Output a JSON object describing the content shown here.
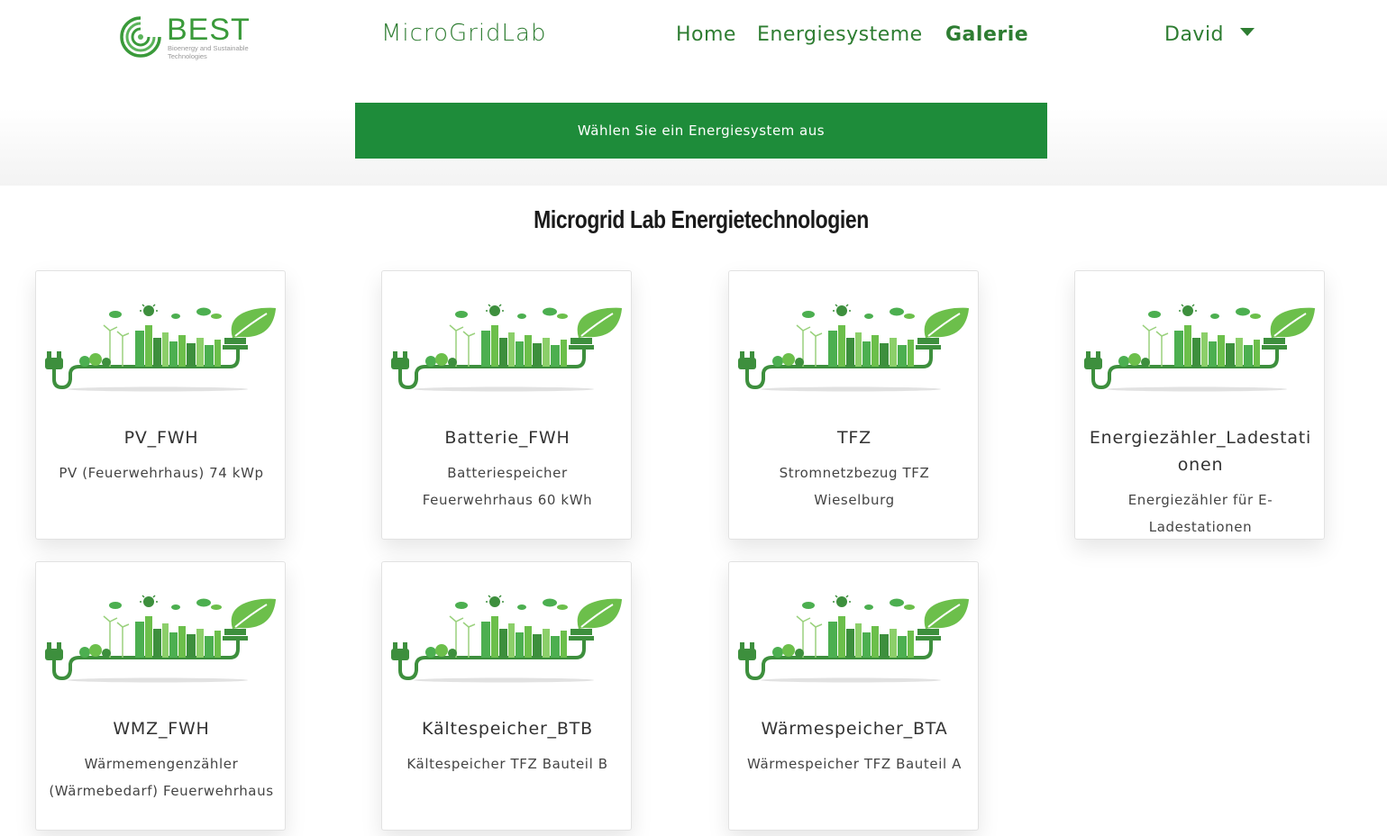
{
  "header": {
    "logo_text": "BEST",
    "logo_sub": "Bioenergy and Sustainable Technologies",
    "brand": "MicroGridLab",
    "nav": [
      {
        "label": "Home"
      },
      {
        "label": "Energiesysteme"
      },
      {
        "label": "Galerie"
      }
    ],
    "user": "David"
  },
  "select_bar": {
    "label": "Wählen Sie ein Energiesystem aus"
  },
  "section": {
    "title": "Microgrid Lab Energietechnologien"
  },
  "cards": [
    {
      "title": "PV_FWH",
      "description": "PV (Feuerwehrhaus) 74 kWp"
    },
    {
      "title": "Batterie_FWH",
      "description": "Batteriespeicher Feuerwehrhaus 60 kWh"
    },
    {
      "title": "TFZ",
      "description": "Stromnetzbezug TFZ Wieselburg"
    },
    {
      "title": "Energiezähler_Ladestationen",
      "description": "Energiezähler für E-Ladestationen"
    },
    {
      "title": "WMZ_FWH",
      "description": "Wärmemengenzähler (Wärmebedarf) Feuerwehrhaus"
    },
    {
      "title": "Kältespeicher_BTB",
      "description": "Kältespeicher TFZ Bauteil B"
    },
    {
      "title": "Wärmespeicher_BTA",
      "description": "Wärmespeicher TFZ Bauteil A"
    }
  ],
  "colors": {
    "primary_green": "#1e8c3a",
    "text_green": "#2e7d32",
    "illustration_green": "#4caf50"
  }
}
